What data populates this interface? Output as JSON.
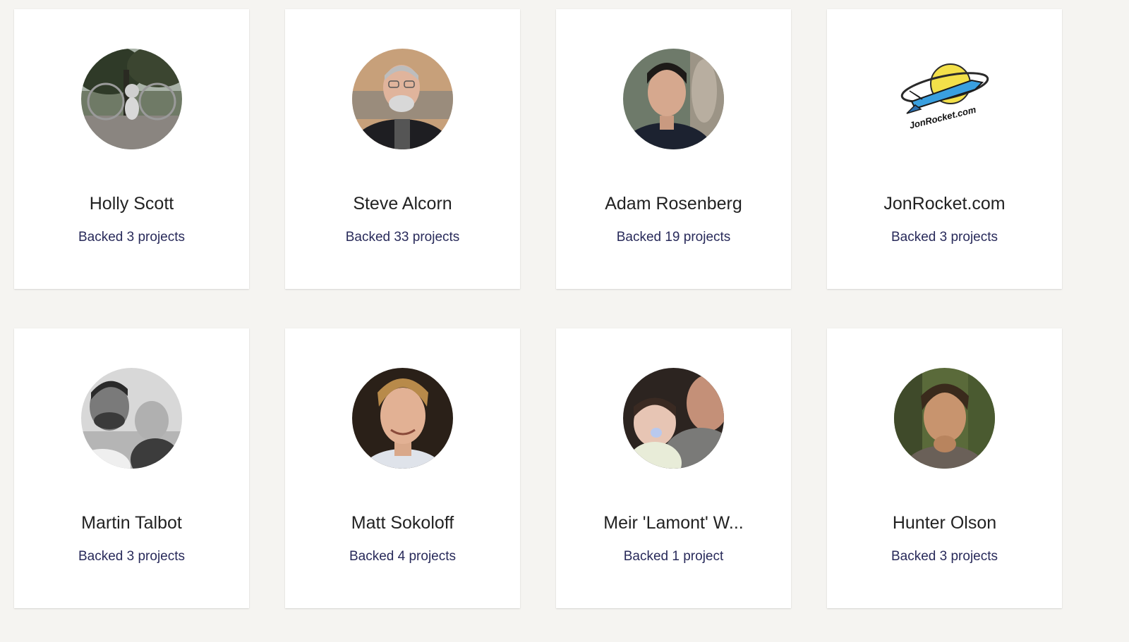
{
  "backers": [
    {
      "name": "Holly Scott",
      "backed": "Backed 3 projects",
      "avatar": "photo-park-icon"
    },
    {
      "name": "Steve Alcorn",
      "backed": "Backed 33 projects",
      "avatar": "photo-man-glasses-icon"
    },
    {
      "name": "Adam Rosenberg",
      "backed": "Backed 19 projects",
      "avatar": "photo-man-icon"
    },
    {
      "name": "JonRocket.com",
      "backed": "Backed 3 projects",
      "avatar": "rocket-logo-icon",
      "logo_text": "JonRocket.com"
    },
    {
      "name": "Martin Talbot",
      "backed": "Backed 3 projects",
      "avatar": "photo-man-child-icon"
    },
    {
      "name": "Matt Sokoloff",
      "backed": "Backed 4 projects",
      "avatar": "photo-man-smiling-icon"
    },
    {
      "name": "Meir 'Lamont' W...",
      "backed": "Backed 1 project",
      "avatar": "photo-baby-icon"
    },
    {
      "name": "Hunter Olson",
      "backed": "Backed 3 projects",
      "avatar": "photo-man-thinking-icon"
    }
  ],
  "colors": {
    "background": "#f5f4f1",
    "card": "#ffffff",
    "name_text": "#222222",
    "link_text": "#282a5a"
  }
}
